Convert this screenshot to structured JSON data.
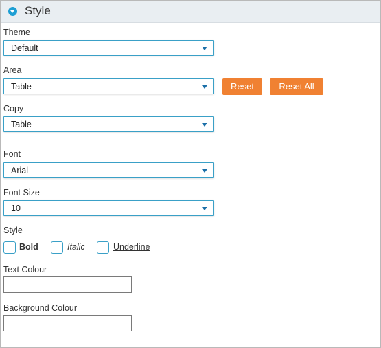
{
  "header": {
    "title": "Style",
    "icon": "chevron-down-circle-icon",
    "accent": "#1e9fd4"
  },
  "fields": {
    "theme": {
      "label": "Theme",
      "value": "Default"
    },
    "area": {
      "label": "Area",
      "value": "Table"
    },
    "copy": {
      "label": "Copy",
      "value": "Table"
    },
    "font": {
      "label": "Font",
      "value": "Arial"
    },
    "font_size": {
      "label": "Font Size",
      "value": "10"
    }
  },
  "buttons": {
    "reset": "Reset",
    "reset_all": "Reset All",
    "color": "#f08132"
  },
  "style": {
    "label": "Style",
    "options": [
      {
        "label": "Bold",
        "checked": false
      },
      {
        "label": "Italic",
        "checked": false
      },
      {
        "label": "Underline",
        "checked": false
      }
    ]
  },
  "colours": {
    "text": {
      "label": "Text Colour",
      "value": ""
    },
    "background": {
      "label": "Background Colour",
      "value": ""
    }
  }
}
